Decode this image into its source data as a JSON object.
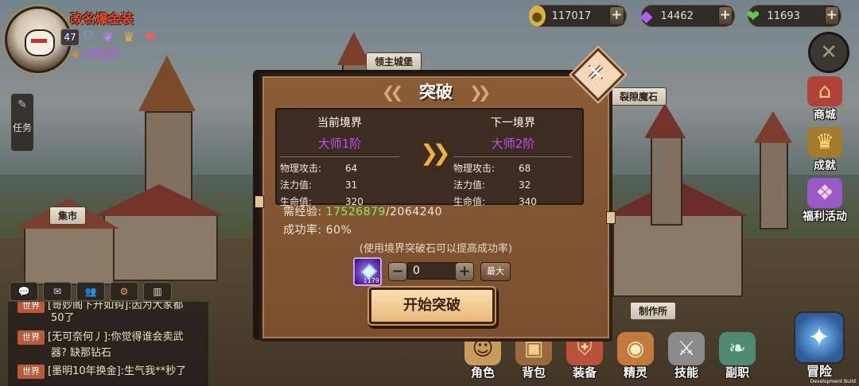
{
  "player": {
    "name": "改名爆金装",
    "level": "47",
    "rank": "大师1阶"
  },
  "currencies": [
    {
      "icon": "gold-coin-icon",
      "value": "117017",
      "color": "#d9b441"
    },
    {
      "icon": "diamond-icon",
      "value": "14462",
      "color": "#b35cff"
    },
    {
      "icon": "heart-gem-icon",
      "value": "11693",
      "color": "#5ecb4b"
    }
  ],
  "left_tab": {
    "label": "任务"
  },
  "map_labels": {
    "market": "集市",
    "city_main": "领主城堡",
    "rift_stone": "裂隙魔石",
    "workshop": "制作所"
  },
  "side_menu": [
    {
      "label": "商城",
      "icon": "shop-icon"
    },
    {
      "label": "成就",
      "icon": "trophy-icon"
    },
    {
      "label": "福利活动",
      "icon": "gift-icon"
    }
  ],
  "chat": {
    "lines": [
      {
        "channel": "世界",
        "text": "[哥妙阁下升如钩]:因为大家都"
      },
      {
        "channel": "",
        "text": "50了"
      },
      {
        "channel": "世界",
        "text": "[无可奈何丿]:你觉得谁会卖武"
      },
      {
        "channel": "",
        "text": "器? 缺那钻石"
      },
      {
        "channel": "世界",
        "text": "[墨明10年换金]:生气我**秒了"
      }
    ]
  },
  "bottom_nav": [
    {
      "label": "角色",
      "icon": "character-icon"
    },
    {
      "label": "背包",
      "icon": "backpack-icon"
    },
    {
      "label": "装备",
      "icon": "equipment-icon"
    },
    {
      "label": "精灵",
      "icon": "sprite-icon"
    },
    {
      "label": "技能",
      "icon": "skill-icon"
    },
    {
      "label": "副职",
      "icon": "sub-job-icon"
    }
  ],
  "adventure": {
    "label": "冒险"
  },
  "dev_build": "Development Build",
  "modal": {
    "title": "突破",
    "current": {
      "heading": "当前境界",
      "rank": "大师1阶",
      "stats": [
        {
          "key": "物理攻击:",
          "value": "64"
        },
        {
          "key": "法力值:",
          "value": "31"
        },
        {
          "key": "生命值:",
          "value": "320"
        }
      ]
    },
    "next": {
      "heading": "下一境界",
      "rank": "大师2阶",
      "stats": [
        {
          "key": "物理攻击:",
          "value": "68"
        },
        {
          "key": "法力值:",
          "value": "32"
        },
        {
          "key": "生命值:",
          "value": "340"
        }
      ]
    },
    "exp_label": "需经验:",
    "exp_current": "17526879",
    "exp_required": "/2064240",
    "rate_label": "成功率:",
    "rate_value": "60%",
    "hint": "(使用境界突破石可以提高成功率)",
    "item_count": "1179",
    "quantity": "0",
    "max_label": "最大",
    "confirm_label": "开始突破"
  }
}
